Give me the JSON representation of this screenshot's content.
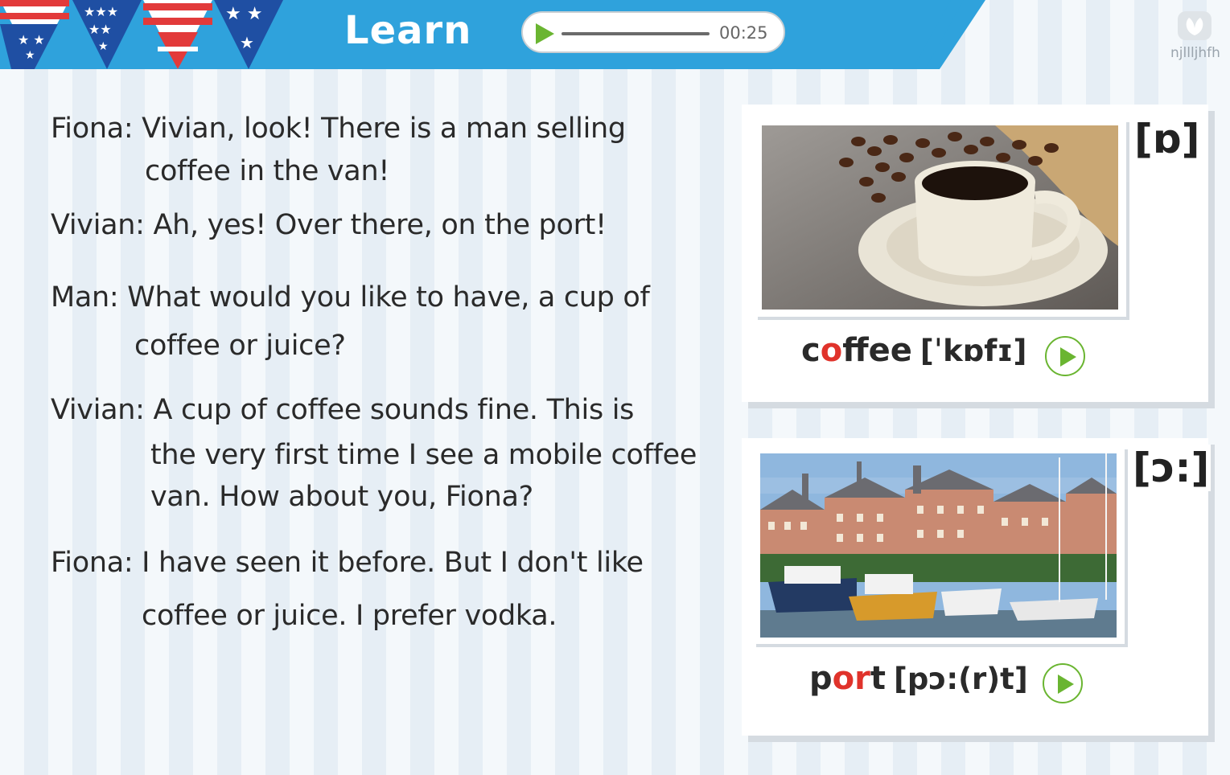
{
  "header": {
    "title": "Learn",
    "audio": {
      "time": "00:25",
      "progress": 0
    },
    "logo_text": "njllljhfh",
    "band_color": "#2fa2dc"
  },
  "dialogue": [
    {
      "speaker_line": "Fiona: Vivian, look! There is a man selling"
    },
    {
      "speaker_line": "coffee in the van!"
    },
    {
      "speaker_line": "Vivian: Ah, yes! Over there, on the port!"
    },
    {
      "speaker_line": "Man: What would you like to have, a cup of"
    },
    {
      "speaker_line": "coffee or juice?"
    },
    {
      "speaker_line": "Vivian: A cup of coffee sounds fine. This is"
    },
    {
      "speaker_line": "the very first time I see a mobile coffee"
    },
    {
      "speaker_line": "van. How about you, Fiona?"
    },
    {
      "speaker_line": "Fiona: I have seen it before. But I don't like"
    },
    {
      "speaker_line": "coffee or juice. I prefer vodka."
    }
  ],
  "cards": [
    {
      "ipa_tag": "[ɒ]",
      "word_pre": "c",
      "word_hl": "o",
      "word_post": "ffee",
      "pron": "[ˈkɒfɪ]",
      "photo": "coffee-cup-photo"
    },
    {
      "ipa_tag": "[ɔ:]",
      "word_pre": "p",
      "word_hl": "or",
      "word_post": "t",
      "pron": "[pɔ:(r)t]",
      "photo": "harbor-photo"
    }
  ],
  "colors": {
    "accent_green": "#6ab531",
    "highlight_red": "#e0332b"
  }
}
